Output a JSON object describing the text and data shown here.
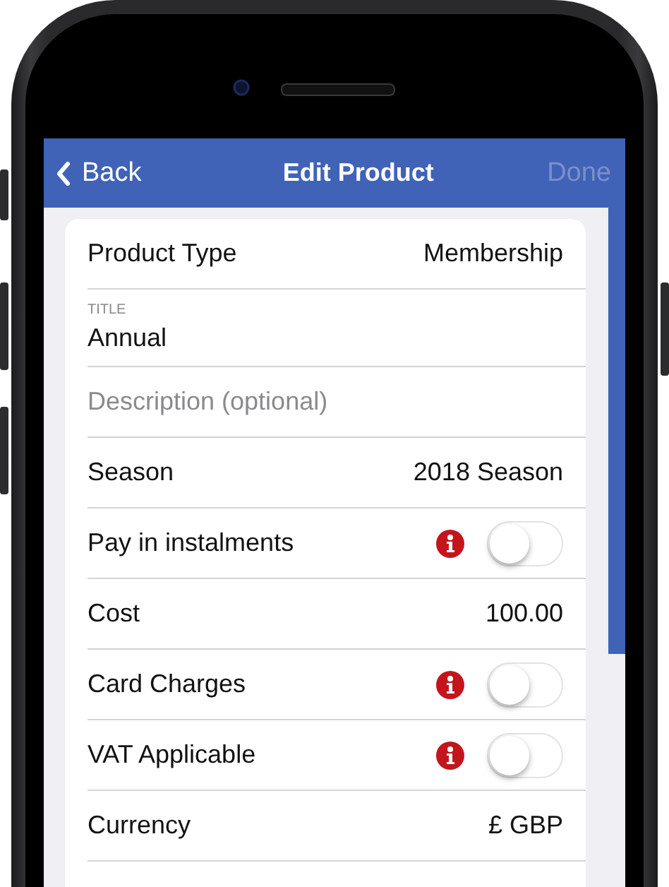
{
  "nav": {
    "back": "Back",
    "title": "Edit Product",
    "done": {
      "label": "Done",
      "disabled": true
    }
  },
  "rows": [
    {
      "kind": "value",
      "label": "Product Type",
      "value": "Membership"
    },
    {
      "kind": "field",
      "caption": "TITLE",
      "value": "Annual"
    },
    {
      "kind": "field",
      "placeholder": "Description (optional)"
    },
    {
      "kind": "value",
      "label": "Season",
      "value": "2018 Season"
    },
    {
      "kind": "toggle",
      "label": "Pay in instalments",
      "info": true,
      "on": false
    },
    {
      "kind": "value",
      "label": "Cost",
      "value": "100.00"
    },
    {
      "kind": "toggle",
      "label": "Card Charges",
      "info": true,
      "on": false
    },
    {
      "kind": "toggle",
      "label": "VAT Applicable",
      "info": true,
      "on": false
    },
    {
      "kind": "value",
      "label": "Currency",
      "value": "£ GBP"
    }
  ]
}
